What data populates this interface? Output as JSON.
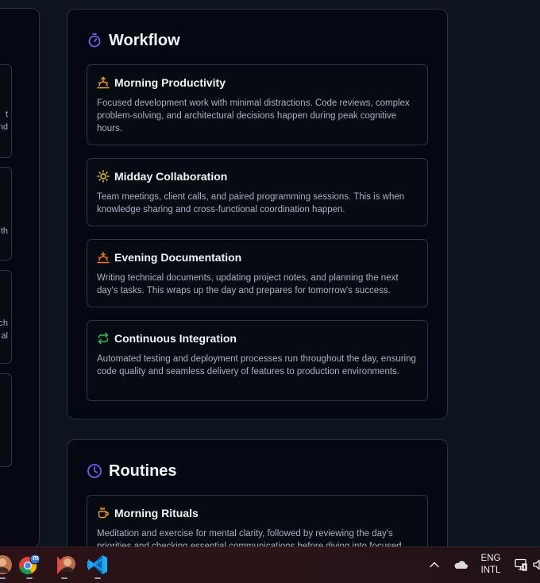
{
  "left_panel": {
    "cards": [
      {
        "fragments": [
          "t",
          "nd"
        ]
      },
      {
        "fragments": [
          "th"
        ]
      },
      {
        "fragments": [
          "ch",
          "al"
        ]
      },
      {
        "fragments": []
      }
    ]
  },
  "workflow": {
    "title": "Workflow",
    "icon": "timer-icon",
    "items": [
      {
        "title": "Morning Productivity",
        "icon": "sunrise-icon",
        "color": "#f59e0b",
        "description": "Focused development work with minimal distractions. Code reviews, complex problem-solving, and architectural decisions happen during peak cognitive hours."
      },
      {
        "title": "Midday Collaboration",
        "icon": "sun-icon",
        "color": "#facc15",
        "description": "Team meetings, client calls, and paired programming sessions. This is when knowledge sharing and cross-functional coordination happen."
      },
      {
        "title": "Evening Documentation",
        "icon": "sunset-icon",
        "color": "#f97316",
        "description": "Writing technical documents, updating project notes, and planning the next day's tasks. This wraps up the day and prepares for tomorrow's success."
      },
      {
        "title": "Continuous Integration",
        "icon": "repeat-icon",
        "color": "#22c55e",
        "description": "Automated testing and deployment processes run throughout the day, ensuring code quality and seamless delivery of features to production environments."
      }
    ]
  },
  "routines": {
    "title": "Routines",
    "icon": "clock-icon",
    "items": [
      {
        "title": "Morning Rituals",
        "icon": "coffee-icon",
        "color": "#f59e0b",
        "description": "Meditation and exercise for mental clarity, followed by reviewing the day's priorities and checking essential communications before diving into focused work."
      }
    ]
  },
  "accent_color": "#6366f1",
  "taskbar": {
    "apps": [
      "avatar-app",
      "chrome-app",
      "avatar-app-2",
      "vscode-app"
    ],
    "chrome_badge": "m",
    "language_top": "ENG",
    "language_bottom": "INTL"
  }
}
